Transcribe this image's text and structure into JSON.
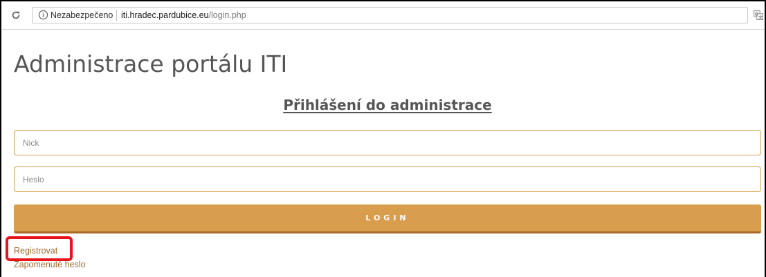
{
  "browser": {
    "reload_icon": "reload-icon",
    "info_icon": "info-icon",
    "security_label": "Nezabezpečeno",
    "url_host": "iti.hradec.pardubice.eu",
    "url_path": "/login.php",
    "translate_icon": "translate-icon"
  },
  "page": {
    "title": "Administrace portálu ITI",
    "login_heading": "Přihlášení do administrace"
  },
  "form": {
    "nick_placeholder": "Nick",
    "nick_value": "",
    "password_placeholder": "Heslo",
    "password_value": "",
    "login_button_label": "LOGIN"
  },
  "links": {
    "register": "Registrovat",
    "forgot_password": "Zapomenuté heslo"
  },
  "colors": {
    "accent": "#d89e4e",
    "link": "#a16b2e",
    "highlight": "#e8131b"
  }
}
